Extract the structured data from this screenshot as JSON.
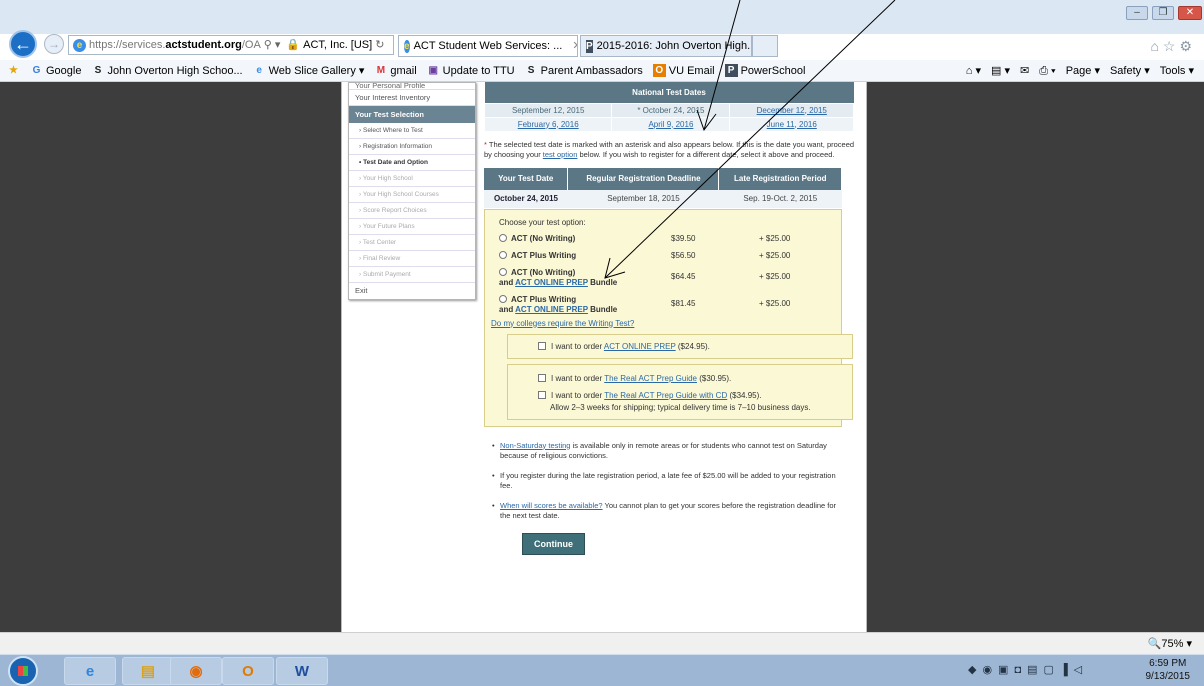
{
  "browser": {
    "url_prefix": "https://services.",
    "url_domain": "actstudent.org",
    "url_path": "/OA",
    "security_label": "ACT, Inc. [US]",
    "tabs": [
      {
        "label": "ACT Student Web Services: ...",
        "active": true
      },
      {
        "label": "2015-2016: John Overton High...",
        "active": false
      }
    ],
    "favorites": [
      {
        "label": "Google",
        "icon": "google-g-icon"
      },
      {
        "label": "John Overton High Schoo...",
        "icon": "school-icon"
      },
      {
        "label": "Web Slice Gallery",
        "icon": "web-slice-icon"
      },
      {
        "label": "gmail",
        "icon": "gmail-icon"
      },
      {
        "label": "Update to TTU",
        "icon": "ttu-icon"
      },
      {
        "label": "Parent Ambassadors",
        "icon": "school-icon"
      },
      {
        "label": "VU Email",
        "icon": "outlook-icon"
      },
      {
        "label": "PowerSchool",
        "icon": "powerschool-icon"
      }
    ],
    "tools": {
      "page": "Page",
      "safety": "Safety",
      "tools": "Tools"
    },
    "zoom": "75%"
  },
  "sidebar": {
    "cut_item": "Your Personal Profile",
    "items": [
      {
        "label": "Your Interest Inventory"
      }
    ],
    "header": "Your Test Selection",
    "steps": [
      {
        "label": "Select Where to Test",
        "state": "done"
      },
      {
        "label": "Registration Information",
        "state": "done"
      },
      {
        "label": "Test Date and Option",
        "state": "current"
      },
      {
        "label": "Your High School",
        "state": "todo"
      },
      {
        "label": "Your High School Courses",
        "state": "todo"
      },
      {
        "label": "Score Report Choices",
        "state": "todo"
      },
      {
        "label": "Your Future Plans",
        "state": "todo"
      },
      {
        "label": "Test Center",
        "state": "todo"
      },
      {
        "label": "Final Review",
        "state": "todo"
      },
      {
        "label": "Submit Payment",
        "state": "todo"
      }
    ],
    "exit": "Exit"
  },
  "national_dates": {
    "title": "National Test Dates",
    "row1": [
      "September 12, 2015",
      "* October 24, 2015",
      "December 12, 2015"
    ],
    "row2": [
      "February 6, 2016",
      "April 9, 2016",
      "June 11, 2016"
    ]
  },
  "note": {
    "asterisk": "*",
    "part1": " The selected test date is marked with an asterisk and also appears below. If this is the date you want, proceed by choosing your ",
    "link": "test option",
    "part2": " below. If you wish to register for a different date, select it above and proceed."
  },
  "your_test": {
    "headers": [
      "Your Test Date",
      "Regular Registration Deadline",
      "Late Registration Period"
    ],
    "values": [
      "October 24, 2015",
      "September 18, 2015",
      "Sep. 19-Oct. 2, 2015"
    ]
  },
  "options": {
    "prompt": "Choose your test option:",
    "items": [
      {
        "line1": "ACT (No Writing)",
        "prefix": "",
        "link": "",
        "suffix": "",
        "price": "$39.50",
        "late_fee": "+ $25.00"
      },
      {
        "line1": "ACT Plus Writing",
        "prefix": "",
        "link": "",
        "suffix": "",
        "price": "$56.50",
        "late_fee": "+ $25.00"
      },
      {
        "line1": "ACT (No Writing)",
        "prefix": "and ",
        "link": "ACT ONLINE PREP",
        "suffix": " Bundle",
        "price": "$64.45",
        "late_fee": "+ $25.00"
      },
      {
        "line1": "ACT Plus Writing",
        "prefix": "and ",
        "link": "ACT ONLINE PREP",
        "suffix": " Bundle",
        "price": "$81.45",
        "late_fee": "+ $25.00"
      }
    ],
    "writing_link": "Do my colleges require the Writing Test?"
  },
  "addons": {
    "online_prep": {
      "pre": "I want to order ",
      "link": "ACT ONLINE PREP",
      "post": " ($24.95)."
    },
    "guide": {
      "pre": "I want to order ",
      "link": "The Real ACT Prep Guide",
      "post": " ($30.95)."
    },
    "guide_cd": {
      "pre": "I want to order ",
      "link": "The Real ACT Prep Guide with CD",
      "post": " ($34.95)."
    },
    "shipping": "Allow 2–3 weeks for shipping; typical delivery time is 7–10 business days."
  },
  "bullets": {
    "b1_link": "Non-Saturday testing",
    "b1_text": " is available only in remote areas or for students who cannot test on Saturday because of religious convictions.",
    "b2_text": "If you register during the late registration period, a late fee of $25.00 will be added to your registration fee.",
    "b3_link": "When will scores be available?",
    "b3_text": " You cannot plan to get your scores before the registration deadline for the next test date."
  },
  "continue_label": "Continue",
  "taskbar": {
    "time": "6:59 PM",
    "date": "9/13/2015",
    "apps": [
      "ie-icon",
      "file-explorer-icon",
      "orange-app-icon",
      "outlook-icon",
      "word-icon"
    ]
  }
}
